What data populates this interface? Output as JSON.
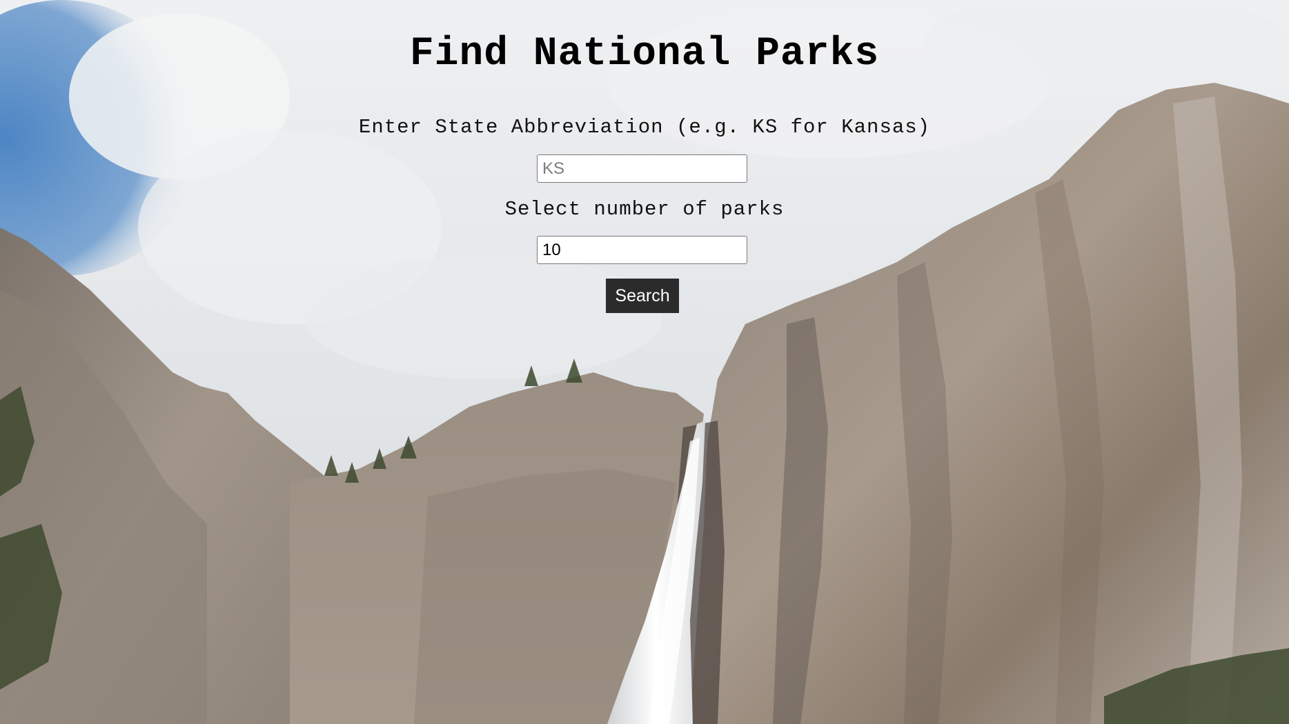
{
  "page": {
    "title": "Find National Parks"
  },
  "form": {
    "state_label": "Enter State Abbreviation (e.g. KS for Kansas)",
    "state_placeholder": "KS",
    "state_value": "",
    "count_label": "Select number of parks",
    "count_value": "10",
    "search_label": "Search"
  },
  "background": {
    "description_colors": {
      "sky_blue": "#5a8fc7",
      "cloud": "#eceef0",
      "granite": "#9c9189",
      "granite_dark": "#5e554f",
      "waterfall": "#f4f5f6",
      "foliage": "#3e4a2f"
    }
  }
}
